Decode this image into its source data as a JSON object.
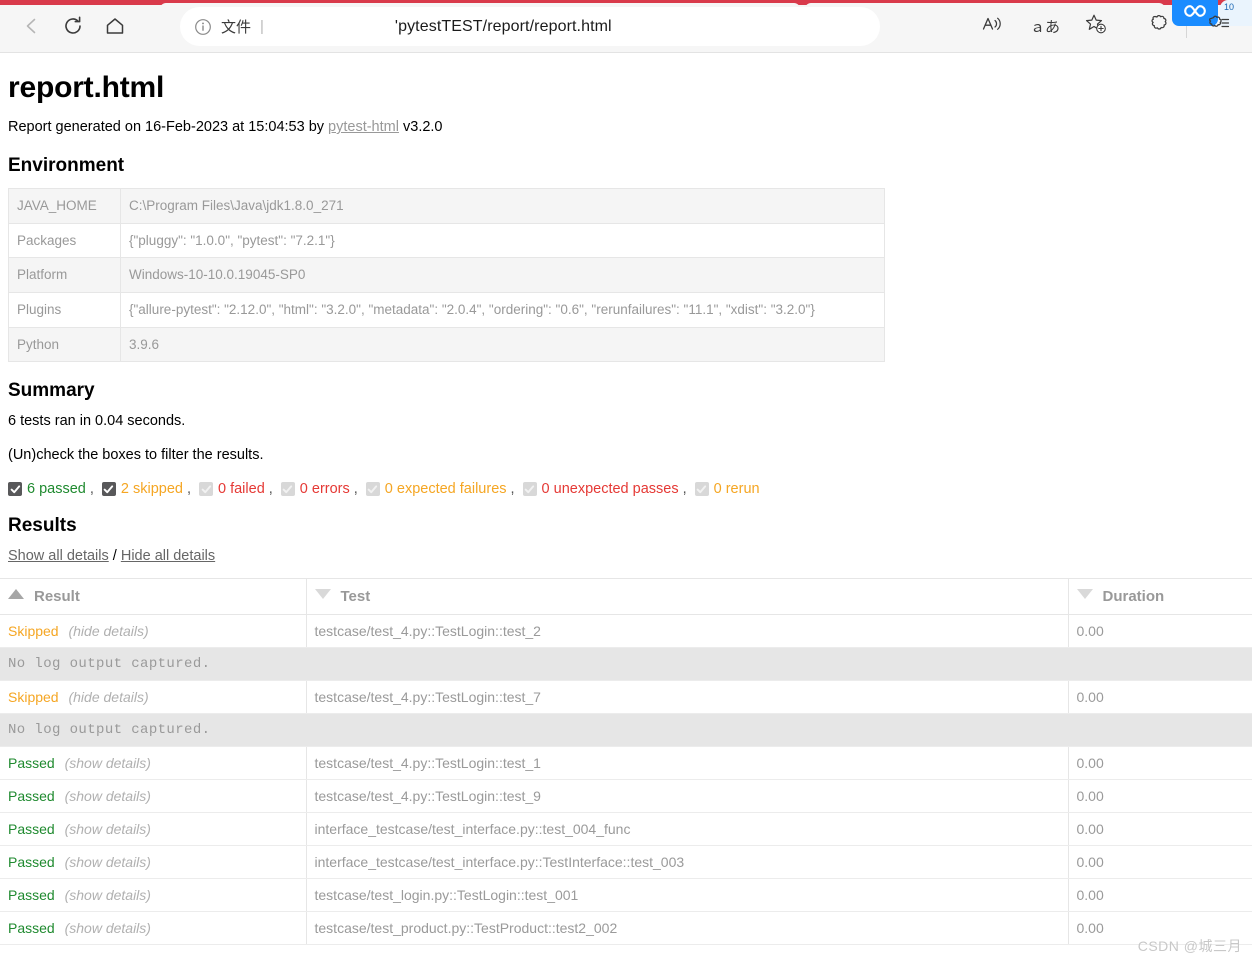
{
  "browser": {
    "back_icon": "back-arrow-icon",
    "reload_icon": "reload-icon",
    "home_icon": "home-icon",
    "info_icon": "info-circle-icon",
    "file_label": "文件",
    "url_separator": "|",
    "url": "'pytestTEST/report/report.html",
    "read_aloud_icon": "read-aloud-icon",
    "translate_icon": "translate-icon",
    "favorites_icon": "favorite-star-add-icon",
    "collections_icon": "collections-icon",
    "settings_icon": "browser-essentials-icon",
    "extension_badge_icon": "infinity-icon",
    "tab_fragment_text": "10"
  },
  "page": {
    "title": "report.html",
    "generated_prefix": "Report generated on 16-Feb-2023 at 15:04:53 by",
    "generator_link": "pytest-html",
    "generator_version": "v3.2.0",
    "watermark": "CSDN @城三月"
  },
  "environment": {
    "heading": "Environment",
    "rows": [
      {
        "key": "JAVA_HOME",
        "value": "C:\\Program Files\\Java\\jdk1.8.0_271"
      },
      {
        "key": "Packages",
        "value": "{\"pluggy\": \"1.0.0\", \"pytest\": \"7.2.1\"}"
      },
      {
        "key": "Platform",
        "value": "Windows-10-10.0.19045-SP0"
      },
      {
        "key": "Plugins",
        "value": "{\"allure-pytest\": \"2.12.0\", \"html\": \"3.2.0\", \"metadata\": \"2.0.4\", \"ordering\": \"0.6\", \"rerunfailures\": \"11.1\", \"xdist\": \"3.2.0\"}"
      },
      {
        "key": "Python",
        "value": "3.9.6"
      }
    ]
  },
  "summary": {
    "heading": "Summary",
    "run_line": "6 tests ran in 0.04 seconds.",
    "filter_hint": "(Un)check the boxes to filter the results.",
    "filters": [
      {
        "label": "6 passed",
        "checked": true,
        "color": "#1f8a2f",
        "trailing": ","
      },
      {
        "label": "2 skipped",
        "checked": true,
        "color": "#f5a623",
        "trailing": ","
      },
      {
        "label": "0 failed",
        "checked": false,
        "color": "#e53935",
        "trailing": ","
      },
      {
        "label": "0 errors",
        "checked": false,
        "color": "#e53935",
        "trailing": ","
      },
      {
        "label": "0 expected failures",
        "checked": false,
        "color": "#f5a623",
        "trailing": ","
      },
      {
        "label": "0 unexpected passes",
        "checked": false,
        "color": "#e53935",
        "trailing": ","
      },
      {
        "label": "0 rerun",
        "checked": false,
        "color": "#f5a623",
        "trailing": ""
      }
    ]
  },
  "results": {
    "heading": "Results",
    "show_all": "Show all details",
    "separator": "/",
    "hide_all": "Hide all details",
    "columns": [
      {
        "label": "Result",
        "sort": "asc"
      },
      {
        "label": "Test",
        "sort": "desc"
      },
      {
        "label": "Duration",
        "sort": "desc"
      }
    ],
    "rows": [
      {
        "status": "Skipped",
        "status_class": "status-skipped",
        "toggle": "(hide details)",
        "test": "testcase/test_4.py::TestLogin::test_2",
        "duration": "0.00",
        "log": "No log output captured."
      },
      {
        "status": "Skipped",
        "status_class": "status-skipped",
        "toggle": "(hide details)",
        "test": "testcase/test_4.py::TestLogin::test_7",
        "duration": "0.00",
        "log": "No log output captured."
      },
      {
        "status": "Passed",
        "status_class": "status-passed",
        "toggle": "(show details)",
        "test": "testcase/test_4.py::TestLogin::test_1",
        "duration": "0.00",
        "log": null
      },
      {
        "status": "Passed",
        "status_class": "status-passed",
        "toggle": "(show details)",
        "test": "testcase/test_4.py::TestLogin::test_9",
        "duration": "0.00",
        "log": null
      },
      {
        "status": "Passed",
        "status_class": "status-passed",
        "toggle": "(show details)",
        "test": "interface_testcase/test_interface.py::test_004_func",
        "duration": "0.00",
        "log": null
      },
      {
        "status": "Passed",
        "status_class": "status-passed",
        "toggle": "(show details)",
        "test": "interface_testcase/test_interface.py::TestInterface::test_003",
        "duration": "0.00",
        "log": null
      },
      {
        "status": "Passed",
        "status_class": "status-passed",
        "toggle": "(show details)",
        "test": "testcase/test_login.py::TestLogin::test_001",
        "duration": "0.00",
        "log": null
      },
      {
        "status": "Passed",
        "status_class": "status-passed",
        "toggle": "(show details)",
        "test": "testcase/test_product.py::TestProduct::test2_002",
        "duration": "0.00",
        "log": null
      }
    ]
  }
}
